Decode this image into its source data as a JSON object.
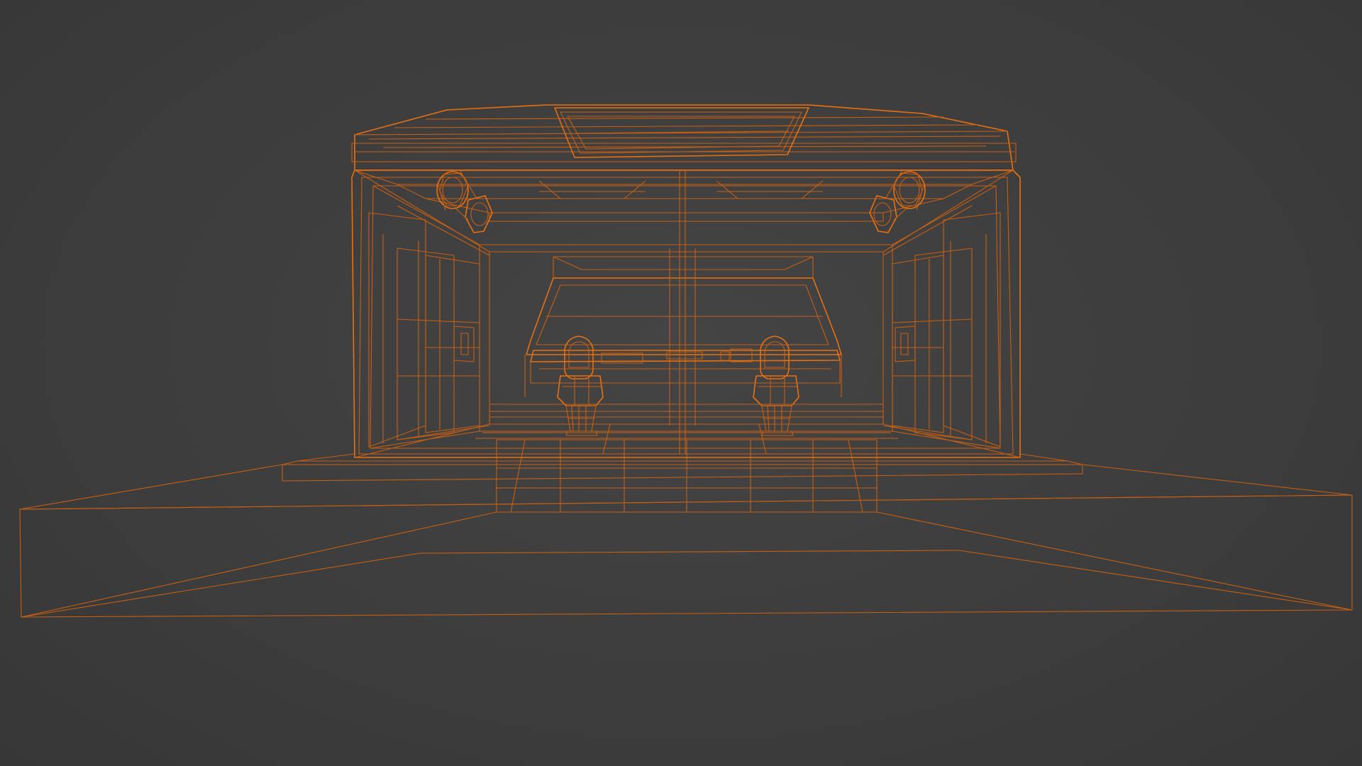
{
  "viewport": {
    "mode": "wireframe",
    "background_color": "#3d3d3d",
    "wire_color": "#e8700f",
    "wire_color_dim": "#c75f12"
  },
  "objects": [
    {
      "name": "ground-plane"
    },
    {
      "name": "base-platform"
    },
    {
      "name": "front-step"
    },
    {
      "name": "room-outer-shell"
    },
    {
      "name": "roof-cap"
    },
    {
      "name": "roof-skylight"
    },
    {
      "name": "back-wall-window"
    },
    {
      "name": "left-wall-panels"
    },
    {
      "name": "right-wall-panels"
    },
    {
      "name": "center-divider"
    },
    {
      "name": "left-ceiling-lamp"
    },
    {
      "name": "right-ceiling-lamp"
    },
    {
      "name": "left-chair"
    },
    {
      "name": "right-chair"
    },
    {
      "name": "console-desk"
    },
    {
      "name": "floor-grid"
    }
  ]
}
